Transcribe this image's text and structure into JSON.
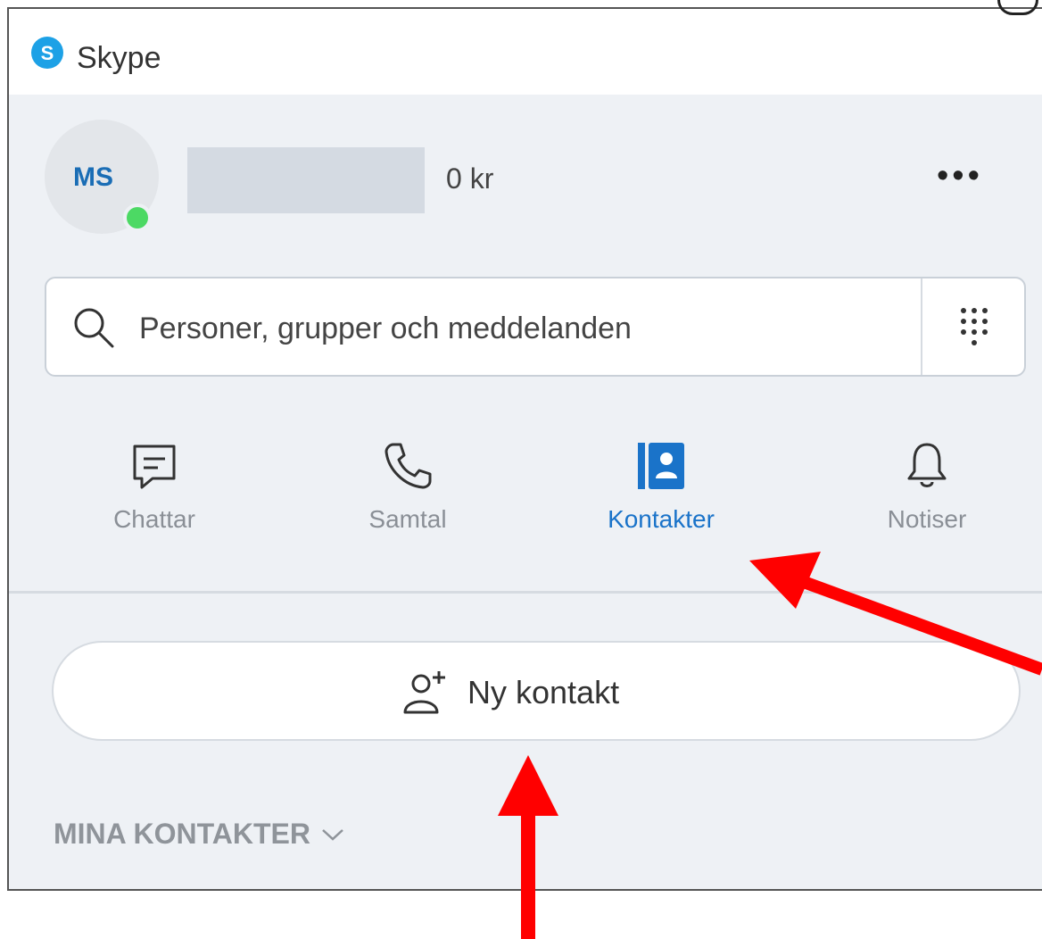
{
  "window": {
    "app_title": "Skype"
  },
  "profile": {
    "initials": "MS",
    "credit": "0 kr",
    "more_label": "•••"
  },
  "search": {
    "placeholder": "Personer, grupper och meddelanden"
  },
  "tabs": [
    {
      "label": "Chattar",
      "icon": "chat-icon",
      "active": false
    },
    {
      "label": "Samtal",
      "icon": "phone-icon",
      "active": false
    },
    {
      "label": "Kontakter",
      "icon": "contacts-icon",
      "active": true
    },
    {
      "label": "Notiser",
      "icon": "bell-icon",
      "active": false
    }
  ],
  "actions": {
    "new_contact_label": "Ny kontakt"
  },
  "sections": {
    "my_contacts": "MINA KONTAKTER"
  },
  "colors": {
    "accent": "#1a73c9",
    "status_online": "#4cd964",
    "annotation_arrow": "#ff0000",
    "pane_background": "#eef1f5"
  }
}
